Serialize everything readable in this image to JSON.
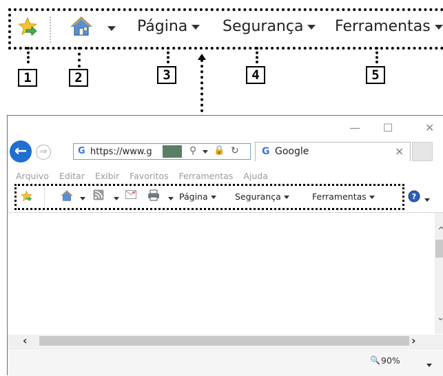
{
  "zoomed_toolbar": {
    "page_label": "Página",
    "security_label": "Segurança",
    "tools_label": "Ferramentas"
  },
  "callouts": [
    "1",
    "2",
    "3",
    "4",
    "5"
  ],
  "browser": {
    "window_controls": {
      "minimize": "—",
      "maximize": "☐",
      "close": "✕"
    },
    "address_text": "https://www.g",
    "tab_title": "Google",
    "tab_close": "×",
    "menu": [
      "Arquivo",
      "Editar",
      "Exibir",
      "Favoritos",
      "Ferramentas",
      "Ajuda"
    ],
    "command_bar": {
      "page_label": "Página",
      "security_label": "Segurança",
      "tools_label": "Ferramentas"
    },
    "zoom_level": "90%"
  },
  "icons": {
    "favorites": "star-with-arrow-icon",
    "home": "home-icon",
    "rss": "rss-feed-icon",
    "mail": "read-mail-icon",
    "print": "printer-icon",
    "help": "help-icon"
  },
  "colors": {
    "back_button": "#1f6fcf",
    "favorites_star": "#f4c430",
    "favorites_arrow": "#4caf50"
  }
}
